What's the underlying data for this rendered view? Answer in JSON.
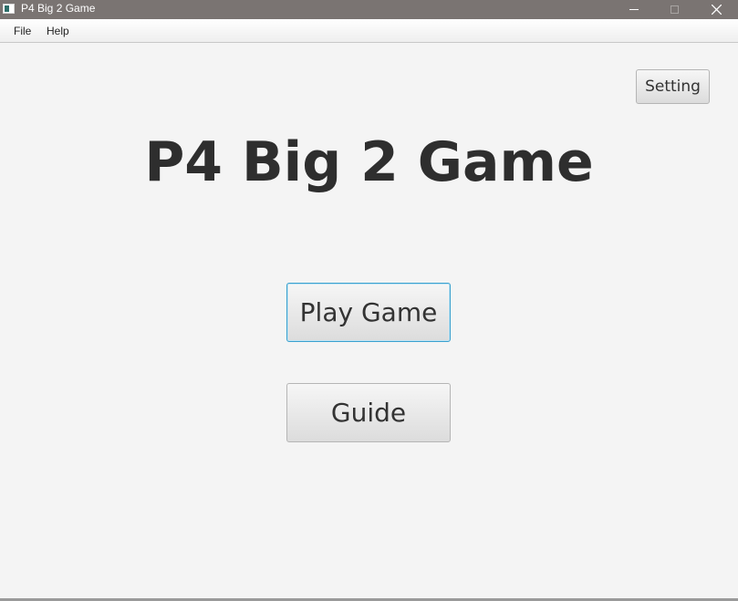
{
  "window": {
    "title": "P4 Big 2 Game",
    "icon": "app-icon",
    "controls": [
      "minimize-icon",
      "maximize-icon",
      "close-icon"
    ]
  },
  "menu": {
    "items": [
      "File",
      "Help"
    ]
  },
  "main": {
    "title": "P4 Big 2 Game",
    "setting_label": "Setting",
    "play_label": "Play Game",
    "guide_label": "Guide"
  },
  "colors": {
    "titlebar": "#7a7472",
    "background": "#f4f4f4",
    "focus_border": "#3aa1cf",
    "title_text": "#2e2e2e"
  }
}
